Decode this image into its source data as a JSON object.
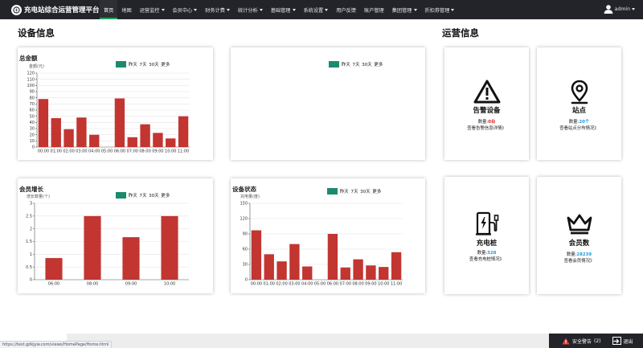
{
  "app": {
    "title": "充电站综合运营管理平台"
  },
  "nav": {
    "items": [
      {
        "label": "首页",
        "active": true,
        "dropdown": false
      },
      {
        "label": "地图",
        "active": false,
        "dropdown": false
      },
      {
        "label": "运营监控",
        "active": false,
        "dropdown": true
      },
      {
        "label": "会员中心",
        "active": false,
        "dropdown": true
      },
      {
        "label": "财务计费",
        "active": false,
        "dropdown": true
      },
      {
        "label": "统计分析",
        "active": false,
        "dropdown": true
      },
      {
        "label": "基础管理",
        "active": false,
        "dropdown": true
      },
      {
        "label": "系统设置",
        "active": false,
        "dropdown": true
      },
      {
        "label": "用户反馈",
        "active": false,
        "dropdown": false
      },
      {
        "label": "账户管理",
        "active": false,
        "dropdown": false
      },
      {
        "label": "集团管理",
        "active": false,
        "dropdown": true
      },
      {
        "label": "折扣券管理",
        "active": false,
        "dropdown": true
      }
    ],
    "user": "admin"
  },
  "sections": {
    "device": "设备信息",
    "ops": "运营信息"
  },
  "range_tabs": {
    "today": "今日",
    "yesterday": "昨天",
    "days7": "7天",
    "days30": "30天",
    "more": "更多"
  },
  "charts": {
    "total": {
      "title": "总金额",
      "unit": "金额(元)"
    },
    "member": {
      "title": "会员增长",
      "unit": "增长数量(个)"
    },
    "device": {
      "title": "设备状态",
      "unit": "充电量(度)"
    }
  },
  "chart_data": [
    {
      "id": "total-amount",
      "type": "bar",
      "title": "总金额",
      "ylabel": "金额(元)",
      "categories": [
        "00:00",
        "01:00",
        "02:00",
        "03:00",
        "04:00",
        "05:00",
        "06:00",
        "07:00",
        "08:00",
        "09:00",
        "10:00",
        "11:00"
      ],
      "values": [
        78,
        47,
        29,
        48,
        20,
        0,
        79,
        16,
        37,
        23,
        14,
        50
      ],
      "ylim": [
        0,
        120
      ],
      "yticks": [
        0,
        10,
        20,
        30,
        40,
        50,
        60,
        70,
        80,
        90,
        100,
        110,
        120
      ],
      "bar_color": "#c23531",
      "grid": true
    },
    {
      "id": "empty-chart",
      "type": "bar",
      "title": "",
      "categories": [],
      "values": []
    },
    {
      "id": "member-growth",
      "type": "bar",
      "title": "会员增长",
      "ylabel": "增长数量(个)",
      "categories": [
        "06:00",
        "08:00",
        "09:00",
        "10:00"
      ],
      "values": [
        0.85,
        2.5,
        1.67,
        2.5
      ],
      "ylim": [
        0,
        3
      ],
      "yticks": [
        0,
        0.5,
        1,
        1.5,
        2,
        2.5,
        3
      ],
      "bar_color": "#c23531",
      "grid": true
    },
    {
      "id": "device-status",
      "type": "bar",
      "title": "设备状态",
      "ylabel": "充电量(度)",
      "categories": [
        "00:00",
        "01:00",
        "02:00",
        "03:00",
        "04:00",
        "05:00",
        "06:00",
        "07:00",
        "08:00",
        "09:00",
        "10:00",
        "11:00"
      ],
      "values": [
        97,
        50,
        36,
        70,
        26,
        0,
        90,
        24,
        40,
        28,
        25,
        54
      ],
      "ylim": [
        0,
        150
      ],
      "yticks": [
        0,
        30,
        60,
        90,
        120,
        150
      ],
      "bar_color": "#c23531",
      "grid": true
    }
  ],
  "ops": {
    "alarm": {
      "name": "告警设备",
      "count_label": "数量:",
      "count": "0台",
      "count_color": "#e02020",
      "link": "查看告警信息详情》"
    },
    "station": {
      "name": "站点",
      "count_label": "数量:",
      "count": "20个",
      "count_color": "#1e9be0",
      "link": "查看站点分布情况》"
    },
    "pile": {
      "name": "充电桩",
      "count_label": "数量:",
      "count": "328",
      "count_color": "#1e9be0",
      "link": "查看充电桩情况》"
    },
    "member": {
      "name": "会员数",
      "count_label": "数量:",
      "count": "28239",
      "count_color": "#1e9be0",
      "link": "查看会员情况》"
    }
  },
  "bottom": {
    "url": "https://test.gdkjyw.com/views/HomePage/Home.html",
    "alarm_label": "安全警告",
    "alarm_count": "(2)",
    "logout_label": "退出"
  }
}
